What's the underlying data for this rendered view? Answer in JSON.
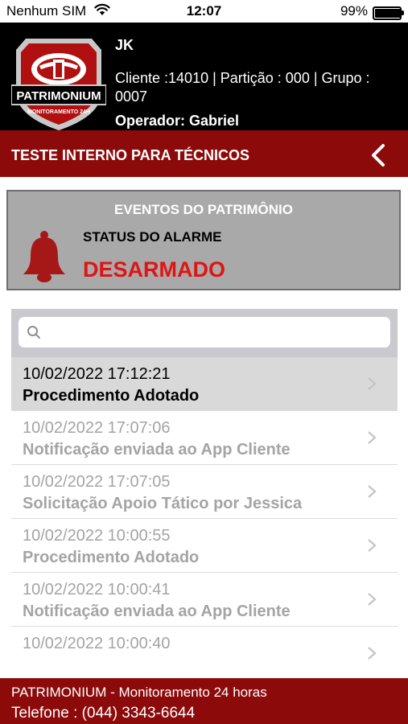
{
  "status_bar": {
    "carrier": "Nenhum SIM",
    "time": "12:07",
    "battery": "99%",
    "battery_level": 0.99
  },
  "header": {
    "logo_text": "PATRIMONIUM",
    "logo_subtext": "MONITORAMENTO 24H",
    "name": "JK",
    "client_info": "Cliente :14010 | Partição : 000 | Grupo : 0007",
    "operator": "Operador: Gabriel"
  },
  "titlebar": {
    "title": "TESTE INTERNO PARA TÉCNICOS"
  },
  "events_panel": {
    "title": "EVENTOS DO PATRIMÔNIO",
    "status_label": "STATUS DO ALARME",
    "status_value": "DESARMADO",
    "status_color": "#e01414"
  },
  "search": {
    "placeholder": ""
  },
  "events": [
    {
      "date": "10/02/2022 17:12:21",
      "description": "Procedimento Adotado"
    },
    {
      "date": "10/02/2022 17:07:06",
      "description": "Notificação enviada ao App Cliente"
    },
    {
      "date": "10/02/2022 17:07:05",
      "description": "Solicitação Apoio Tático por Jessica"
    },
    {
      "date": "10/02/2022 10:00:55",
      "description": "Procedimento Adotado"
    },
    {
      "date": "10/02/2022 10:00:41",
      "description": "Notificação enviada ao App Cliente"
    },
    {
      "date": "10/02/2022 10:00:40",
      "description": ""
    }
  ],
  "footer": {
    "line1": "PATRIMONIUM - Monitoramento 24 horas",
    "line2": "Telefone : (044) 3343-6644"
  },
  "colors": {
    "brand_red": "#8c0a0a",
    "alarm_red": "#e01414"
  }
}
